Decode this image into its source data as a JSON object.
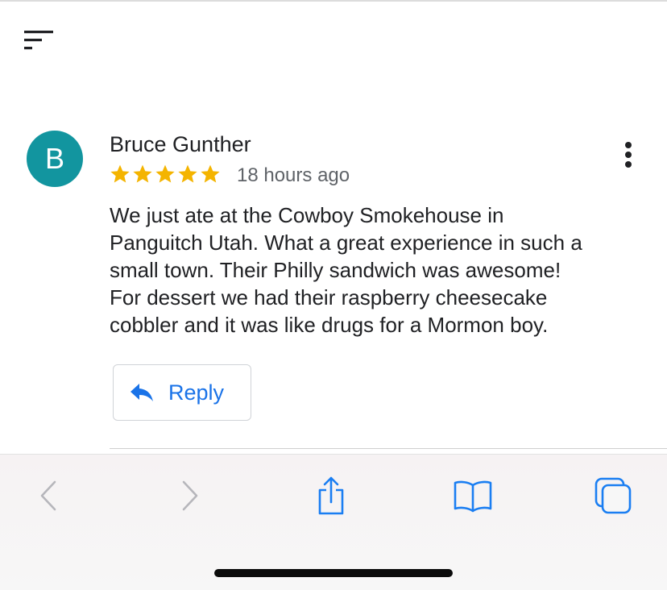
{
  "app": {
    "sort_icon": "sort-icon",
    "more_icon": "more-vert-icon"
  },
  "review": {
    "avatar_letter": "B",
    "avatar_color": "#12959f",
    "author": "Bruce Gunther",
    "rating": 5,
    "rating_max": 5,
    "star_icon": "star-icon",
    "star_color": "#f4b400",
    "time": "18 hours ago",
    "text_lines": [
      "We just ate at the Cowboy Smokehouse in",
      "Panguitch Utah. What a great experience in such a",
      "small town. Their Philly sandwich was awesome!",
      "For dessert we had their raspberry cheesecake",
      "cobbler and it was like drugs for a Mormon boy."
    ],
    "reply_label": "Reply",
    "reply_icon": "reply-arrow-icon",
    "accent_color": "#1a73e8"
  },
  "browser_toolbar": {
    "items": [
      {
        "name": "back-button",
        "icon": "chevron-left-icon"
      },
      {
        "name": "forward-button",
        "icon": "chevron-right-icon"
      },
      {
        "name": "share-button",
        "icon": "share-icon"
      },
      {
        "name": "bookmarks-button",
        "icon": "book-icon"
      },
      {
        "name": "tabs-button",
        "icon": "tabs-icon"
      }
    ],
    "icon_color": "#1a7ef2",
    "disabled_color": "#b6b6bb"
  }
}
